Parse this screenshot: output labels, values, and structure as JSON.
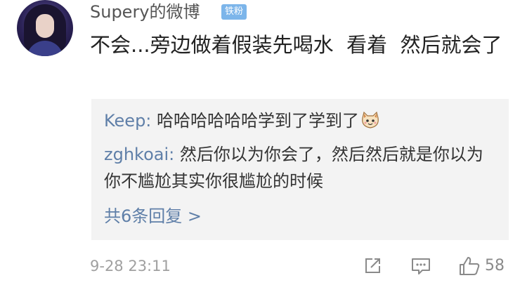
{
  "post": {
    "username": "Supery的微博",
    "badge": "铁粉",
    "comment_text": "不会...旁边做着假装先喝水  看着  然后就会了",
    "timestamp": "9-28 23:11",
    "like_count": "58"
  },
  "replies": [
    {
      "author": "Keep:",
      "text": " 哈哈哈哈哈哈学到了学到了",
      "emoji": "cat-emoji"
    },
    {
      "author": "zghkoai:",
      "text": " 然后你以为你会了，然后然后就是你以为你不尴尬其实你很尴尬的时候"
    }
  ],
  "more_replies": "共6条回复 >",
  "icons": {
    "share": "share-icon",
    "comment": "comment-icon",
    "like": "thumbs-up-icon"
  },
  "colors": {
    "link": "#5f7fa8",
    "badge": "#7cb5ea",
    "reply_bg": "#f3f3f3"
  }
}
